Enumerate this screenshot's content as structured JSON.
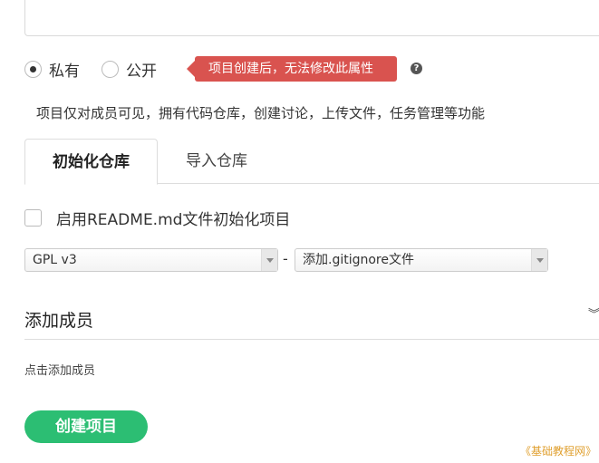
{
  "visibility": {
    "options": [
      {
        "label": "私有",
        "checked": true
      },
      {
        "label": "公开",
        "checked": false
      }
    ],
    "warning": "项目创建后，无法修改此属性",
    "help_icon": "?",
    "description": "项目仅对成员可见，拥有代码仓库，创建讨论，上传文件，任务管理等功能"
  },
  "tabs": [
    {
      "label": "初始化仓库",
      "active": true
    },
    {
      "label": "导入仓库",
      "active": false
    }
  ],
  "readme": {
    "label": "启用README.md文件初始化项目",
    "checked": false
  },
  "license_select": {
    "value": "GPL v3"
  },
  "separator": "-",
  "gitignore_select": {
    "value": "添加.gitignore文件"
  },
  "members": {
    "title": "添加成员",
    "chevron": "≫",
    "hint": "点击添加成员"
  },
  "create_button": {
    "label": "创建项目"
  },
  "watermark": "《基础教程网》",
  "colors": {
    "warning": "#d9534f",
    "primary": "#2cbe73",
    "watermark": "#e0a030"
  }
}
